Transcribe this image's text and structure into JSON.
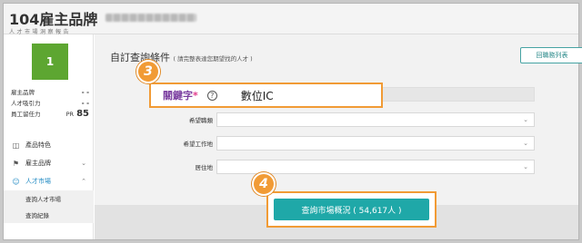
{
  "brand": {
    "logo_num": "104",
    "logo_text": "雇主品牌",
    "logo_sub": "人才市場洞察報告"
  },
  "sidebar": {
    "avatar_text": "1",
    "stats": [
      {
        "label": "雇主品牌",
        "value": "- -"
      },
      {
        "label": "人才吸引力",
        "value": "- -"
      },
      {
        "label": "員工留任力",
        "prefix": "PR",
        "value": "85"
      }
    ],
    "nav": [
      {
        "label": "產品特色",
        "icon": "info-icon"
      },
      {
        "label": "雇主品牌",
        "icon": "flag-icon",
        "chevron": "⌄"
      },
      {
        "label": "人才市場",
        "icon": "people-icon",
        "chevron": "⌃"
      }
    ],
    "sub_items": [
      "查詢人才市場",
      "查詢紀錄"
    ]
  },
  "main": {
    "title": "自訂查詢條件",
    "subtitle": "( 請完整表達您期望找的人才 )",
    "back_button": "回職務列表",
    "rows": [
      {
        "label": "希望職類"
      },
      {
        "label": "希望工作地"
      },
      {
        "label": "居住地"
      }
    ],
    "keyword": {
      "label": "關鍵字",
      "required": "*",
      "help": "?",
      "value": "數位IC"
    },
    "search_button": "查詢市場概況 ( 54,617人 )"
  },
  "callouts": {
    "step3": "3",
    "step4": "4"
  },
  "colors": {
    "accent": "#1fa8a8",
    "callout": "#f19b35",
    "avatar": "#5da631",
    "keyword_label": "#7b3fa0"
  }
}
